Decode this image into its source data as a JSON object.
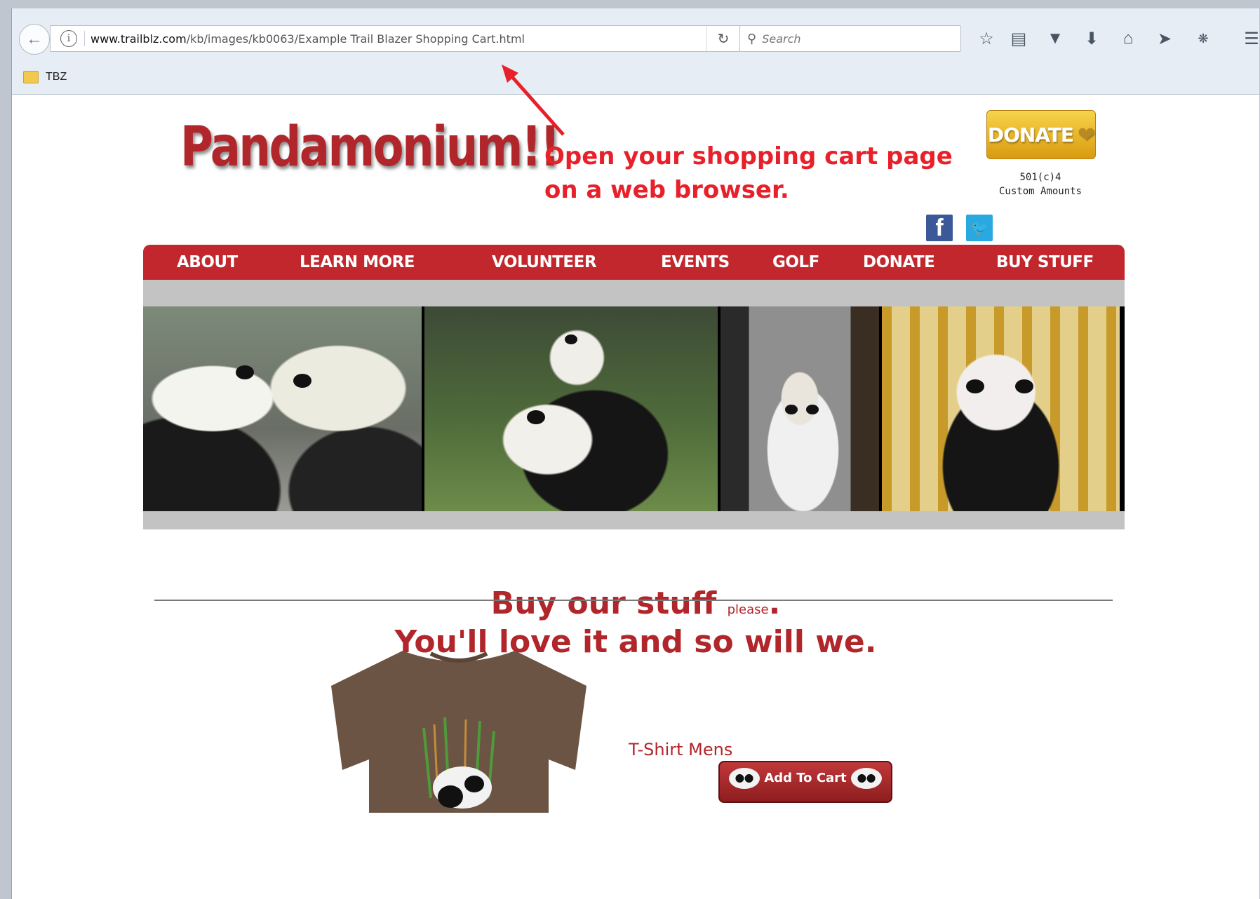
{
  "browser": {
    "url_domain": "www.trailblz.com",
    "url_path": "/kb/images/kb0063/Example Trail Blazer Shopping Cart.html",
    "search_placeholder": "Search",
    "bookmarks": [
      {
        "label": "TBZ"
      }
    ],
    "toolbar_icons": [
      "star-icon",
      "reading-list-icon",
      "pocket-icon",
      "download-icon",
      "home-icon",
      "send-icon",
      "extension-icon",
      "menu-icon"
    ]
  },
  "site": {
    "logo": "Pandamonium!!",
    "callout_line1": "Open your shopping cart page",
    "callout_line2": "on a web browser.",
    "donate_button": "DONATE",
    "donate_note_line1": "501(c)4",
    "donate_note_line2": "Custom Amounts",
    "social": {
      "facebook": "f",
      "twitter": "🐦"
    },
    "nav": [
      "ABOUT",
      "LEARN MORE",
      "VOLUNTEER",
      "EVENTS",
      "GOLF",
      "DONATE",
      "BUY STUFF"
    ],
    "headline_main": "Buy our stuff",
    "headline_small": "please",
    "headline_period": ".",
    "headline_line2": "You'll love it and so will we.",
    "product": {
      "name": "T-Shirt Mens",
      "button": "Add To Cart"
    }
  },
  "colors": {
    "accent_red": "#c1272d",
    "headline_red": "#b0262a",
    "callout_red": "#e8202a",
    "donate_gold": "#f2c230"
  }
}
